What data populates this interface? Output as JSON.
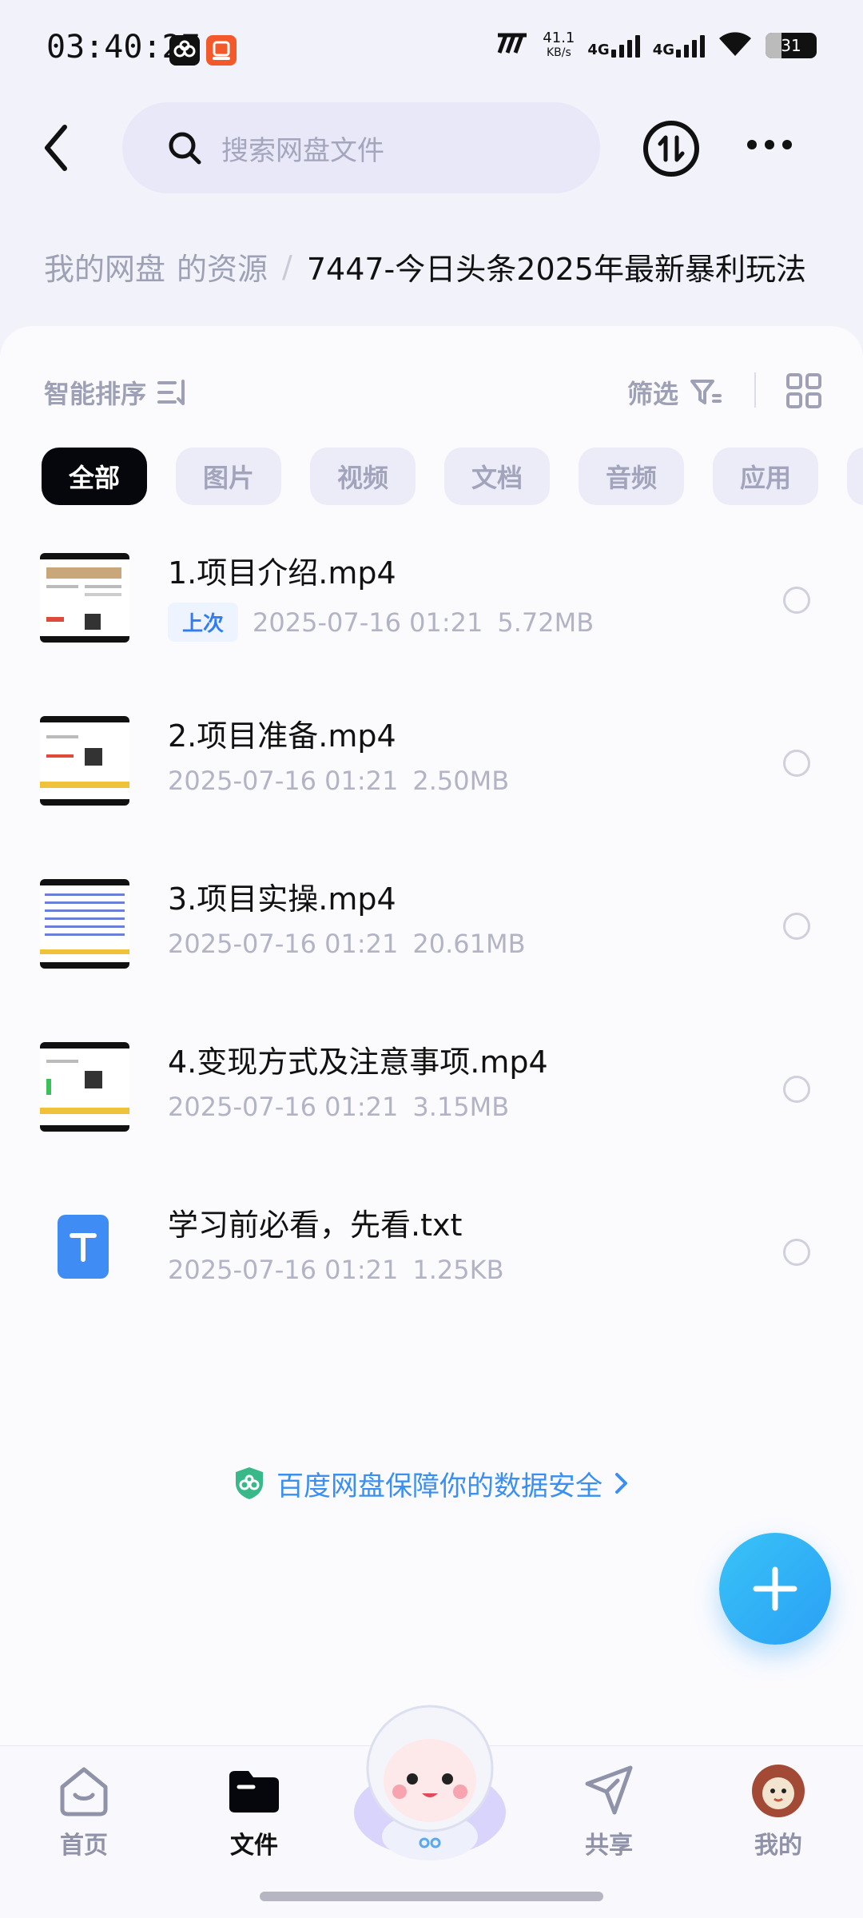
{
  "status_bar": {
    "time": "03:40:27",
    "net_speed": "41.1",
    "net_speed_unit": "KB/s",
    "signal1_label": "4G",
    "signal2_label": "4G",
    "battery": "31",
    "battery_level_pct": 31
  },
  "header": {
    "search_placeholder": "搜索网盘文件"
  },
  "breadcrumb": {
    "root": "我的网盘",
    "parent": "的资源",
    "separator": "/",
    "current": "7447-今日头条2025年最新暴利玩法"
  },
  "toolbar": {
    "sort_label": "智能排序",
    "filter_label": "筛选"
  },
  "chips": [
    "全部",
    "图片",
    "视频",
    "文档",
    "音频",
    "应用"
  ],
  "files": [
    {
      "name": "1.项目介绍.mp4",
      "badge": "上次",
      "date": "2025-07-16  01:21",
      "size": "5.72MB"
    },
    {
      "name": "2.项目准备.mp4",
      "badge": "",
      "date": "2025-07-16  01:21",
      "size": "2.50MB"
    },
    {
      "name": "3.项目实操.mp4",
      "badge": "",
      "date": "2025-07-16  01:21",
      "size": "20.61MB"
    },
    {
      "name": "4.变现方式及注意事项.mp4",
      "badge": "",
      "date": "2025-07-16  01:21",
      "size": "3.15MB"
    },
    {
      "name": "学习前必看，先看.txt",
      "badge": "",
      "date": "2025-07-16  01:21",
      "size": "1.25KB"
    }
  ],
  "security_banner": "百度网盘保障你的数据安全",
  "bottom_nav": {
    "home": "首页",
    "files": "文件",
    "share": "共享",
    "mine": "我的"
  },
  "colors": {
    "accent": "#2aa0f5",
    "banner_text": "#3a8ff0",
    "active_chip": "#05070d"
  }
}
